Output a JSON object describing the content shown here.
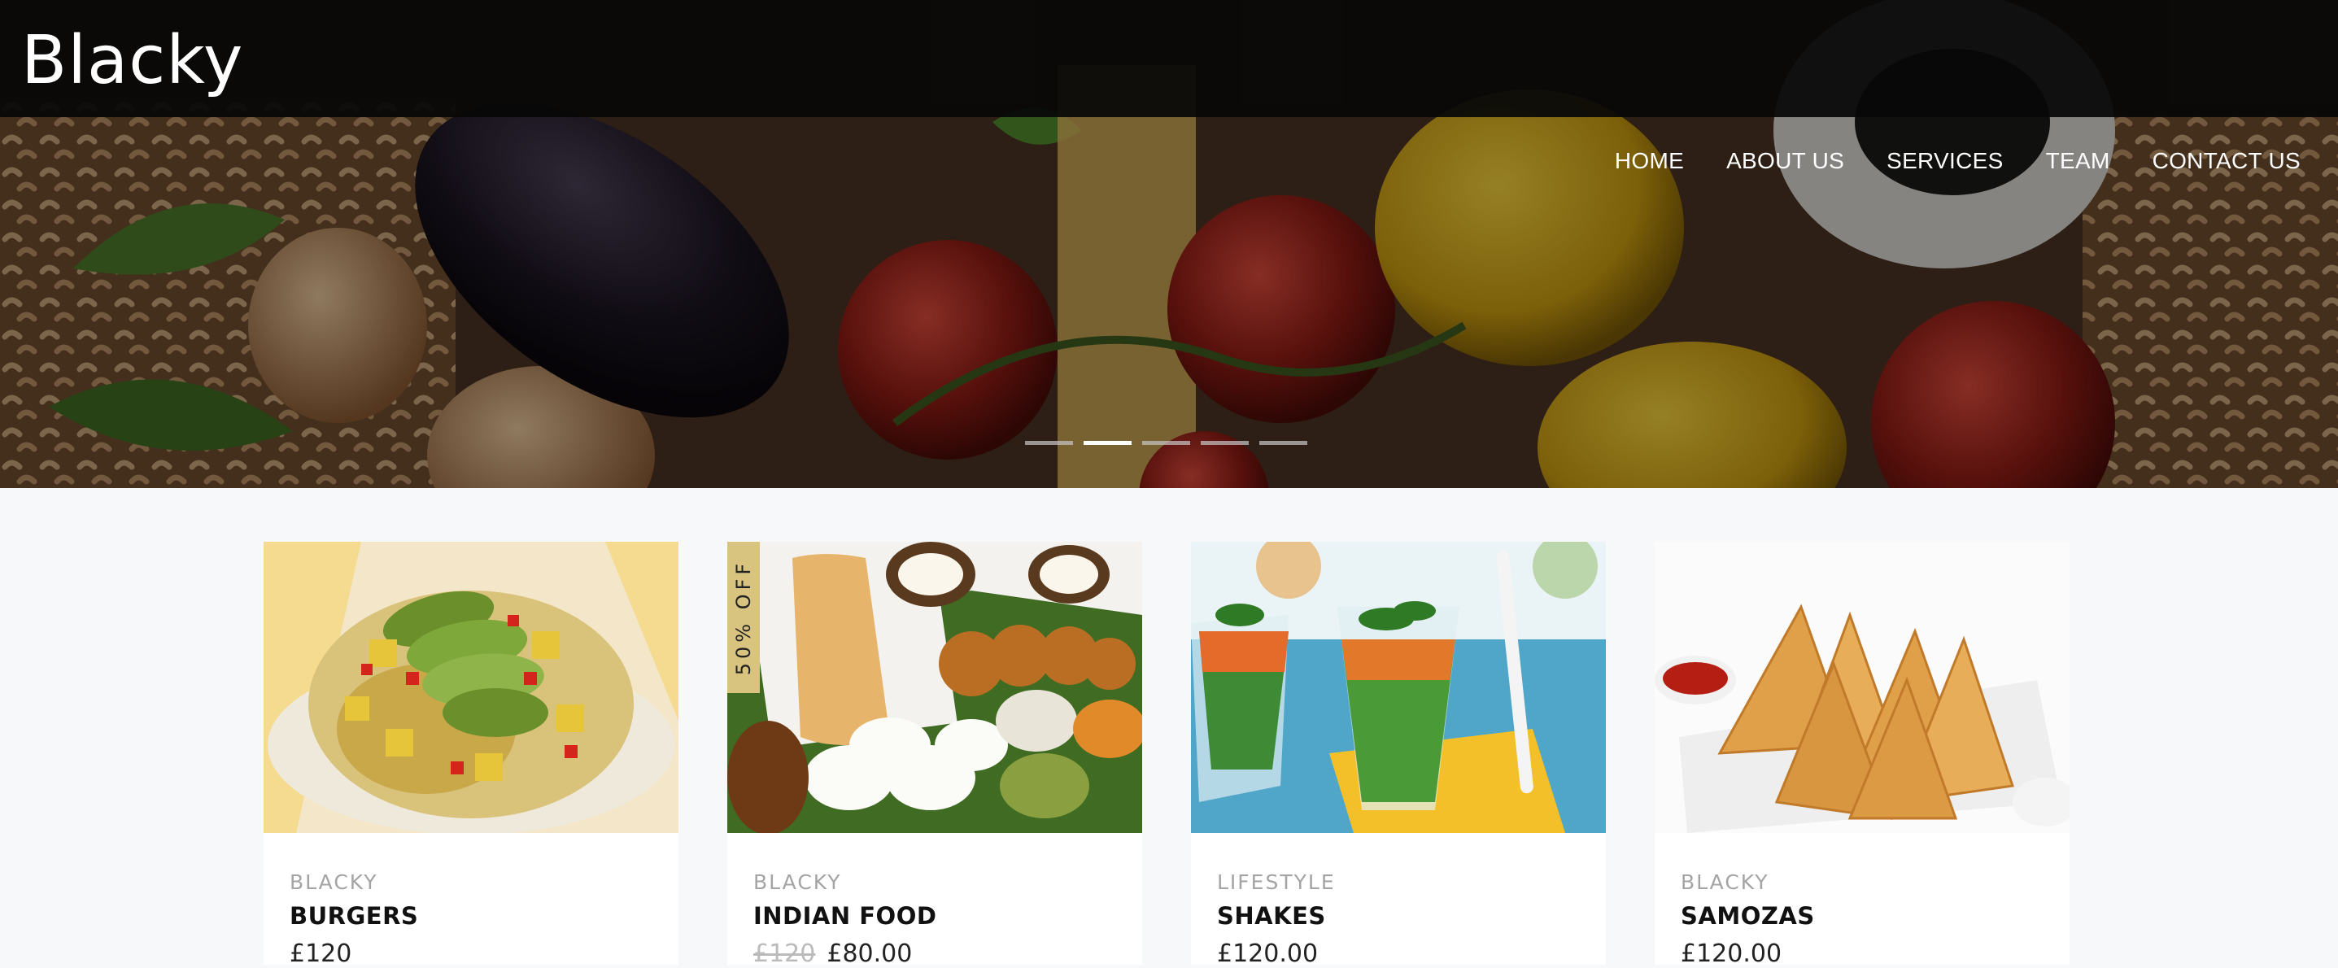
{
  "brand": {
    "logo": "Blacky"
  },
  "nav": {
    "items": [
      {
        "label": "HOME"
      },
      {
        "label": "ABOUT US"
      },
      {
        "label": "SERVICES"
      },
      {
        "label": "TEAM"
      },
      {
        "label": "CONTACT US"
      }
    ]
  },
  "slider": {
    "slide_count": 5,
    "active_index": 1
  },
  "cards": [
    {
      "category": "BLACKY",
      "title": "BURGERS",
      "price": "£120",
      "old_price": "",
      "badge": ""
    },
    {
      "category": "BLACKY",
      "title": "INDIAN FOOD",
      "price": "£80.00",
      "old_price": "£120",
      "badge": "50% OFF"
    },
    {
      "category": "LIFESTYLE",
      "title": "SHAKES",
      "price": "£120.00",
      "old_price": "",
      "badge": ""
    },
    {
      "category": "BLACKY",
      "title": "SAMOZAS",
      "price": "£120.00",
      "old_price": "",
      "badge": ""
    }
  ],
  "colors": {
    "badge": "#d8c47f",
    "topbar": "#080808",
    "page_bg": "#f7f8fa"
  }
}
